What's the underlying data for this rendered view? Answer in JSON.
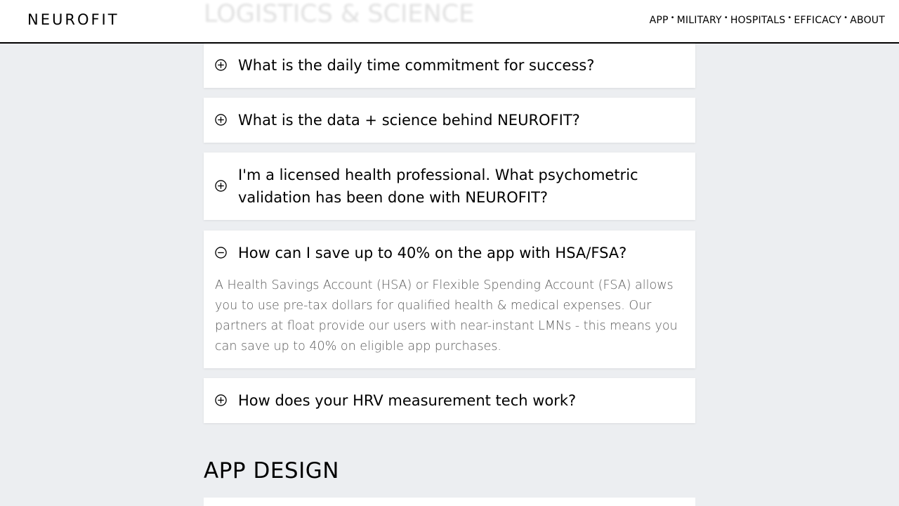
{
  "header": {
    "logo": "NEUROFIT",
    "nav": [
      "APP",
      "MILITARY",
      "HOSPITALS",
      "EFFICACY",
      "ABOUT"
    ],
    "separator": "•"
  },
  "sections": {
    "previous_title": "LOGISTICS & SCIENCE",
    "next_title": "APP DESIGN"
  },
  "faqs": [
    {
      "question": "What is the daily time commitment for success?",
      "expanded": false,
      "icon": "plus-circle-icon"
    },
    {
      "question": "What is the data + science behind NEUROFIT?",
      "expanded": false,
      "icon": "plus-circle-icon"
    },
    {
      "question": "I'm a licensed health professional. What psychometric validation has been done with NEUROFIT?",
      "expanded": false,
      "icon": "plus-circle-icon"
    },
    {
      "question": "How can I save up to 40% on the app with HSA/FSA?",
      "expanded": true,
      "icon": "minus-circle-icon",
      "answer": "A Health Savings Account (HSA) or Flexible Spending Account (FSA) allows you to use pre-tax dollars for qualified health & medical expenses. Our partners at float provide our users with near-instant LMNs - this means you can save up to 40% on eligible app purchases."
    },
    {
      "question": "How does your HRV measurement tech work?",
      "expanded": false,
      "icon": "plus-circle-icon"
    }
  ]
}
